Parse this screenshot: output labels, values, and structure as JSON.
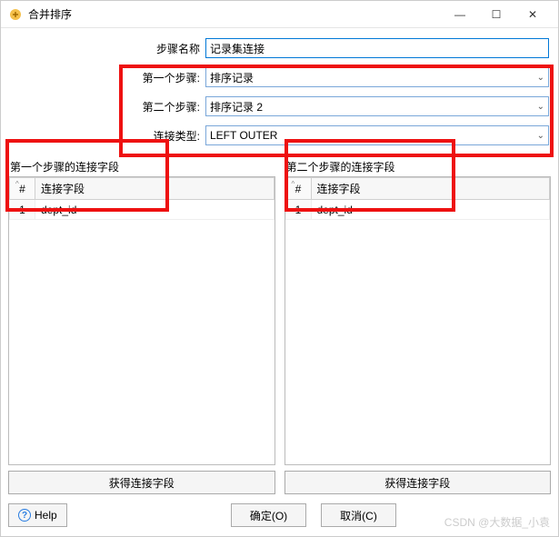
{
  "window": {
    "title": "合并排序"
  },
  "form": {
    "step_name_label": "步骤名称",
    "step_name_value": "记录集连接",
    "step1_label": "第一个步骤:",
    "step1_value": "排序记录",
    "step2_label": "第二个步骤:",
    "step2_value": "排序记录 2",
    "join_type_label": "连接类型:",
    "join_type_value": "LEFT OUTER"
  },
  "left_panel": {
    "title": "第一个步骤的连接字段",
    "num_header": "#",
    "field_header": "连接字段",
    "rows": [
      {
        "num": "1",
        "field": "dept_id"
      }
    ],
    "button": "获得连接字段"
  },
  "right_panel": {
    "title": "第二个步骤的连接字段",
    "num_header": "#",
    "field_header": "连接字段",
    "rows": [
      {
        "num": "1",
        "field": "dept_id"
      }
    ],
    "button": "获得连接字段"
  },
  "buttons": {
    "help": "Help",
    "ok": "确定(O)",
    "cancel": "取消(C)"
  },
  "watermark": "CSDN @大数据_小袁"
}
